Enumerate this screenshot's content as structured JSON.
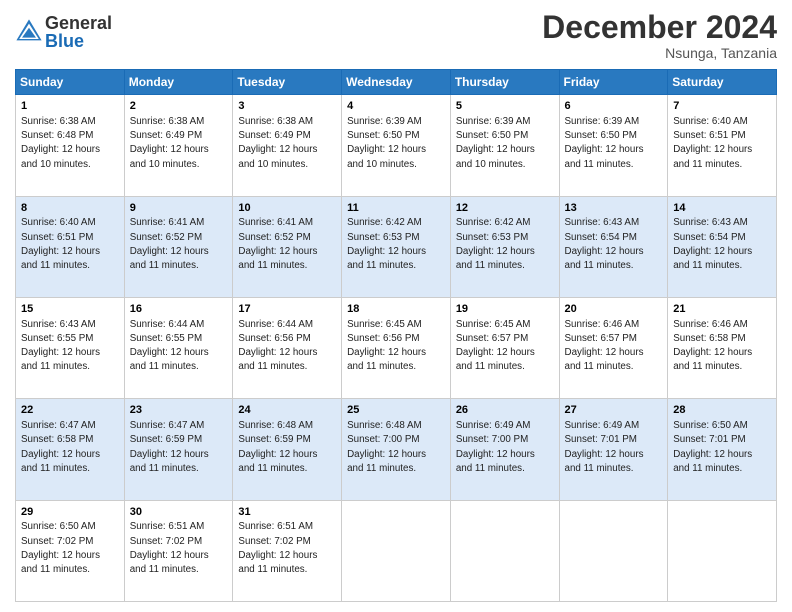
{
  "header": {
    "logo_general": "General",
    "logo_blue": "Blue",
    "month_title": "December 2024",
    "subtitle": "Nsunga, Tanzania"
  },
  "days_of_week": [
    "Sunday",
    "Monday",
    "Tuesday",
    "Wednesday",
    "Thursday",
    "Friday",
    "Saturday"
  ],
  "weeks": [
    [
      {
        "day": "1",
        "info": "Sunrise: 6:38 AM\nSunset: 6:48 PM\nDaylight: 12 hours\nand 10 minutes."
      },
      {
        "day": "2",
        "info": "Sunrise: 6:38 AM\nSunset: 6:49 PM\nDaylight: 12 hours\nand 10 minutes."
      },
      {
        "day": "3",
        "info": "Sunrise: 6:38 AM\nSunset: 6:49 PM\nDaylight: 12 hours\nand 10 minutes."
      },
      {
        "day": "4",
        "info": "Sunrise: 6:39 AM\nSunset: 6:50 PM\nDaylight: 12 hours\nand 10 minutes."
      },
      {
        "day": "5",
        "info": "Sunrise: 6:39 AM\nSunset: 6:50 PM\nDaylight: 12 hours\nand 10 minutes."
      },
      {
        "day": "6",
        "info": "Sunrise: 6:39 AM\nSunset: 6:50 PM\nDaylight: 12 hours\nand 11 minutes."
      },
      {
        "day": "7",
        "info": "Sunrise: 6:40 AM\nSunset: 6:51 PM\nDaylight: 12 hours\nand 11 minutes."
      }
    ],
    [
      {
        "day": "8",
        "info": "Sunrise: 6:40 AM\nSunset: 6:51 PM\nDaylight: 12 hours\nand 11 minutes."
      },
      {
        "day": "9",
        "info": "Sunrise: 6:41 AM\nSunset: 6:52 PM\nDaylight: 12 hours\nand 11 minutes."
      },
      {
        "day": "10",
        "info": "Sunrise: 6:41 AM\nSunset: 6:52 PM\nDaylight: 12 hours\nand 11 minutes."
      },
      {
        "day": "11",
        "info": "Sunrise: 6:42 AM\nSunset: 6:53 PM\nDaylight: 12 hours\nand 11 minutes."
      },
      {
        "day": "12",
        "info": "Sunrise: 6:42 AM\nSunset: 6:53 PM\nDaylight: 12 hours\nand 11 minutes."
      },
      {
        "day": "13",
        "info": "Sunrise: 6:43 AM\nSunset: 6:54 PM\nDaylight: 12 hours\nand 11 minutes."
      },
      {
        "day": "14",
        "info": "Sunrise: 6:43 AM\nSunset: 6:54 PM\nDaylight: 12 hours\nand 11 minutes."
      }
    ],
    [
      {
        "day": "15",
        "info": "Sunrise: 6:43 AM\nSunset: 6:55 PM\nDaylight: 12 hours\nand 11 minutes."
      },
      {
        "day": "16",
        "info": "Sunrise: 6:44 AM\nSunset: 6:55 PM\nDaylight: 12 hours\nand 11 minutes."
      },
      {
        "day": "17",
        "info": "Sunrise: 6:44 AM\nSunset: 6:56 PM\nDaylight: 12 hours\nand 11 minutes."
      },
      {
        "day": "18",
        "info": "Sunrise: 6:45 AM\nSunset: 6:56 PM\nDaylight: 12 hours\nand 11 minutes."
      },
      {
        "day": "19",
        "info": "Sunrise: 6:45 AM\nSunset: 6:57 PM\nDaylight: 12 hours\nand 11 minutes."
      },
      {
        "day": "20",
        "info": "Sunrise: 6:46 AM\nSunset: 6:57 PM\nDaylight: 12 hours\nand 11 minutes."
      },
      {
        "day": "21",
        "info": "Sunrise: 6:46 AM\nSunset: 6:58 PM\nDaylight: 12 hours\nand 11 minutes."
      }
    ],
    [
      {
        "day": "22",
        "info": "Sunrise: 6:47 AM\nSunset: 6:58 PM\nDaylight: 12 hours\nand 11 minutes."
      },
      {
        "day": "23",
        "info": "Sunrise: 6:47 AM\nSunset: 6:59 PM\nDaylight: 12 hours\nand 11 minutes."
      },
      {
        "day": "24",
        "info": "Sunrise: 6:48 AM\nSunset: 6:59 PM\nDaylight: 12 hours\nand 11 minutes."
      },
      {
        "day": "25",
        "info": "Sunrise: 6:48 AM\nSunset: 7:00 PM\nDaylight: 12 hours\nand 11 minutes."
      },
      {
        "day": "26",
        "info": "Sunrise: 6:49 AM\nSunset: 7:00 PM\nDaylight: 12 hours\nand 11 minutes."
      },
      {
        "day": "27",
        "info": "Sunrise: 6:49 AM\nSunset: 7:01 PM\nDaylight: 12 hours\nand 11 minutes."
      },
      {
        "day": "28",
        "info": "Sunrise: 6:50 AM\nSunset: 7:01 PM\nDaylight: 12 hours\nand 11 minutes."
      }
    ],
    [
      {
        "day": "29",
        "info": "Sunrise: 6:50 AM\nSunset: 7:02 PM\nDaylight: 12 hours\nand 11 minutes."
      },
      {
        "day": "30",
        "info": "Sunrise: 6:51 AM\nSunset: 7:02 PM\nDaylight: 12 hours\nand 11 minutes."
      },
      {
        "day": "31",
        "info": "Sunrise: 6:51 AM\nSunset: 7:02 PM\nDaylight: 12 hours\nand 11 minutes."
      },
      null,
      null,
      null,
      null
    ]
  ]
}
